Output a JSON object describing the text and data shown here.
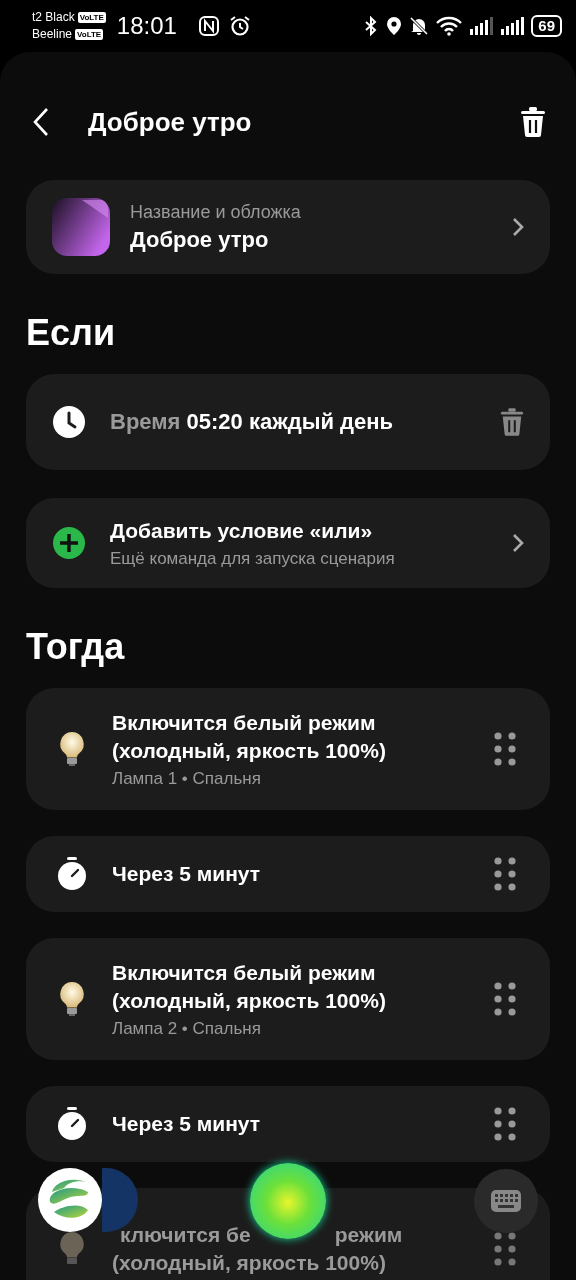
{
  "status_bar": {
    "carriers": [
      {
        "name": "t2 Black",
        "badge": "VoLTE"
      },
      {
        "name": "Beeline",
        "badge": "VoLTE"
      }
    ],
    "time": "18:01",
    "battery": "69"
  },
  "header": {
    "title": "Доброе утро"
  },
  "cover": {
    "label": "Название и обложка",
    "name": "Доброе утро"
  },
  "sections": [
    {
      "title": "Если",
      "items": [
        {
          "kind": "condition",
          "label": "Время",
          "value": "05:20 каждый день"
        },
        {
          "kind": "add",
          "title": "Добавить условие «или»",
          "subtitle": "Ещё команда для запуска сценария"
        }
      ]
    },
    {
      "title": "Тогда",
      "items": [
        {
          "kind": "light",
          "title": "Включится белый режим (холодный, яркость 100%)",
          "subtitle": "Лампа 1 • Спальня"
        },
        {
          "kind": "timer",
          "title": "Через 5 минут"
        },
        {
          "kind": "light",
          "title": "Включится белый режим (холодный, яркость 100%)",
          "subtitle": "Лампа 2 • Спальня"
        },
        {
          "kind": "timer",
          "title": "Через 5 минут"
        },
        {
          "kind": "light_covered",
          "title_parts": [
            "ключится бе",
            "режим"
          ],
          "title_line2": "(холодный, яркость 100%)"
        }
      ]
    }
  ]
}
